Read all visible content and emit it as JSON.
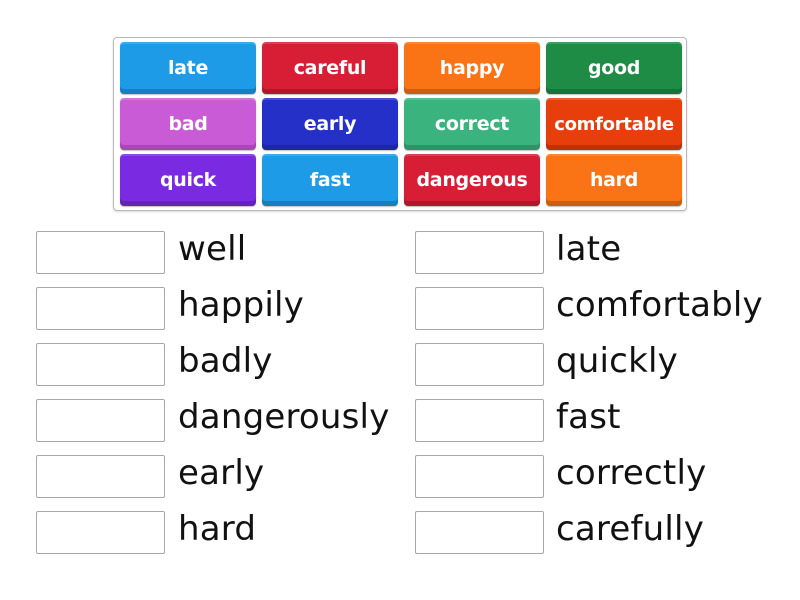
{
  "tiles": [
    {
      "label": "late",
      "color": "#1e9be6"
    },
    {
      "label": "careful",
      "color": "#d81e34"
    },
    {
      "label": "happy",
      "color": "#fa7314"
    },
    {
      "label": "good",
      "color": "#1f8c45"
    },
    {
      "label": "bad",
      "color": "#c95cd6"
    },
    {
      "label": "early",
      "color": "#2430c7"
    },
    {
      "label": "correct",
      "color": "#3bb37e"
    },
    {
      "label": "comfortable",
      "color": "#e83e0c"
    },
    {
      "label": "quick",
      "color": "#7a2ae0"
    },
    {
      "label": "fast",
      "color": "#1e9be6"
    },
    {
      "label": "dangerous",
      "color": "#d81e34"
    },
    {
      "label": "hard",
      "color": "#fa7314"
    }
  ],
  "targets": {
    "left": [
      {
        "word": "well",
        "answer": ""
      },
      {
        "word": "happily",
        "answer": ""
      },
      {
        "word": "badly",
        "answer": ""
      },
      {
        "word": "dangerously",
        "answer": ""
      },
      {
        "word": "early",
        "answer": ""
      },
      {
        "word": "hard",
        "answer": ""
      }
    ],
    "right": [
      {
        "word": "late",
        "answer": ""
      },
      {
        "word": "comfortably",
        "answer": ""
      },
      {
        "word": "quickly",
        "answer": ""
      },
      {
        "word": "fast",
        "answer": ""
      },
      {
        "word": "correctly",
        "answer": ""
      },
      {
        "word": "carefully",
        "answer": ""
      }
    ]
  }
}
